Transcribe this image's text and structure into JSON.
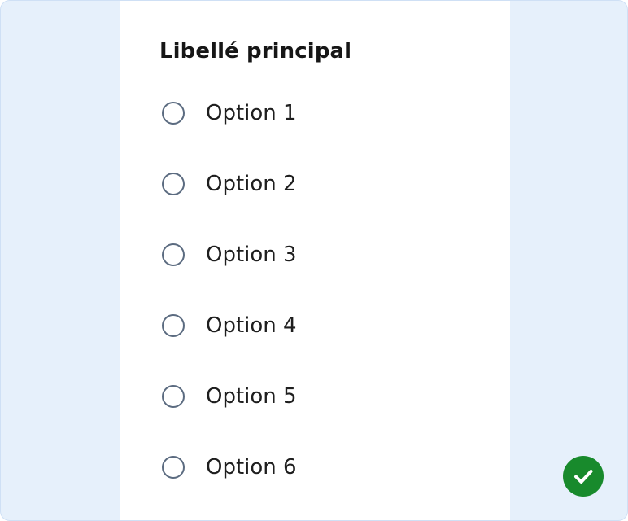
{
  "form": {
    "legend": "Libellé principal",
    "options": [
      {
        "label": "Option 1",
        "checked": false
      },
      {
        "label": "Option 2",
        "checked": false
      },
      {
        "label": "Option 3",
        "checked": false
      },
      {
        "label": "Option 4",
        "checked": false
      },
      {
        "label": "Option 5",
        "checked": false
      },
      {
        "label": "Option 6",
        "checked": false
      }
    ]
  },
  "status": {
    "icon": "check-circle-icon",
    "color": "#188a2c"
  },
  "colors": {
    "frame_background": "#e6f0fb",
    "frame_border": "#cfe0f5",
    "panel_background": "#ffffff",
    "radio_border": "#5b6b80"
  }
}
